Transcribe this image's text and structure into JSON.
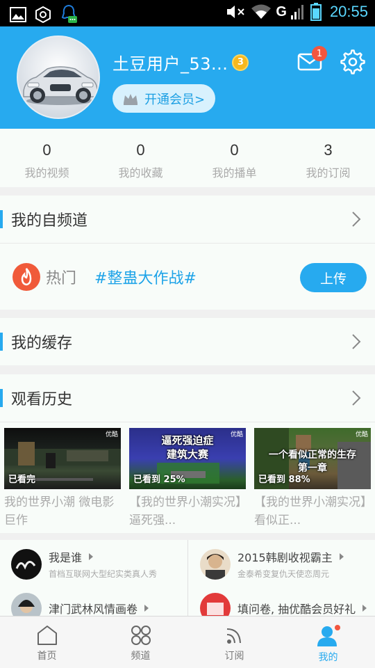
{
  "status_bar": {
    "time": "20:55",
    "network": "G"
  },
  "profile": {
    "username": "土豆用户_53...",
    "level": "3",
    "vip_label": "开通会员>",
    "mail_count": "1"
  },
  "stats": [
    {
      "value": "0",
      "label": "我的视频"
    },
    {
      "value": "0",
      "label": "我的收藏"
    },
    {
      "value": "0",
      "label": "我的播单"
    },
    {
      "value": "3",
      "label": "我的订阅"
    }
  ],
  "channel": {
    "title": "我的自频道",
    "hot_label": "热门",
    "hot_tag": "#整蛊大作战#",
    "upload_label": "上传"
  },
  "cache": {
    "title": "我的缓存"
  },
  "history": {
    "title": "观看历史",
    "items": [
      {
        "progress": "已看完",
        "overlay": "",
        "title": "我的世界小潮 微电影巨作",
        "logo": "优酷"
      },
      {
        "progress": "已看到 25%",
        "overlay": "逼死强迫症\n建筑大赛",
        "title": "【我的世界小潮实况】逼死强...",
        "logo": "优酷"
      },
      {
        "progress": "已看到 88%",
        "overlay": "一个看似正常的生存\n第一章",
        "title": "【我的世界小潮实况】看似正...",
        "logo": "优酷"
      }
    ]
  },
  "recommendations": [
    {
      "title": "我是谁",
      "subtitle": "首档互联网大型纪实类真人秀"
    },
    {
      "title": "2015韩剧收视霸主",
      "subtitle": "金泰希变复仇天使恋周元"
    },
    {
      "title": "津门武林风情画卷",
      "subtitle": ""
    },
    {
      "title": "填问卷, 抽优酷会员好礼",
      "subtitle": ""
    }
  ],
  "nav": [
    {
      "label": "首页",
      "icon": "home-icon",
      "active": false
    },
    {
      "label": "频道",
      "icon": "channel-grid-icon",
      "active": false
    },
    {
      "label": "订阅",
      "icon": "rss-icon",
      "active": false
    },
    {
      "label": "我的",
      "icon": "user-icon",
      "active": true
    }
  ],
  "colors": {
    "accent": "#27aaef",
    "badge": "#f3563f",
    "level": "#f6b81f",
    "flame": "#f05a3a"
  }
}
